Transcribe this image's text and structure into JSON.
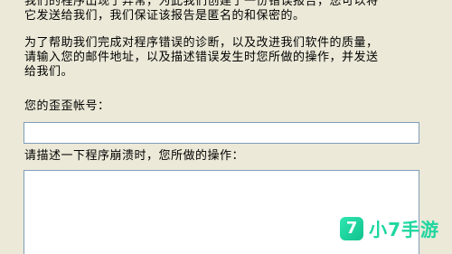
{
  "dialog": {
    "para1": "我们的程序出现了异常，为此我们创建了一份错误报告，您可以将\n它发送给我们，我们保证该报告是匿名的和保密的。",
    "para2": "为了帮助我们完成对程序错误的诊断，以及改进我们软件的质量，\n请输入您的邮件地址，以及描述错误发生时您所做的操作，并发送\n给我们。",
    "account_label": "您的歪歪帐号：",
    "account_value": "",
    "description_label": "请描述一下程序崩溃时，您所做的操作：",
    "description_value": ""
  },
  "watermark": {
    "logo_glyph": "7",
    "text": "小7手游",
    "colors": {
      "logo_bg": "#1fd6a0",
      "text": "#1fd6a0"
    }
  }
}
